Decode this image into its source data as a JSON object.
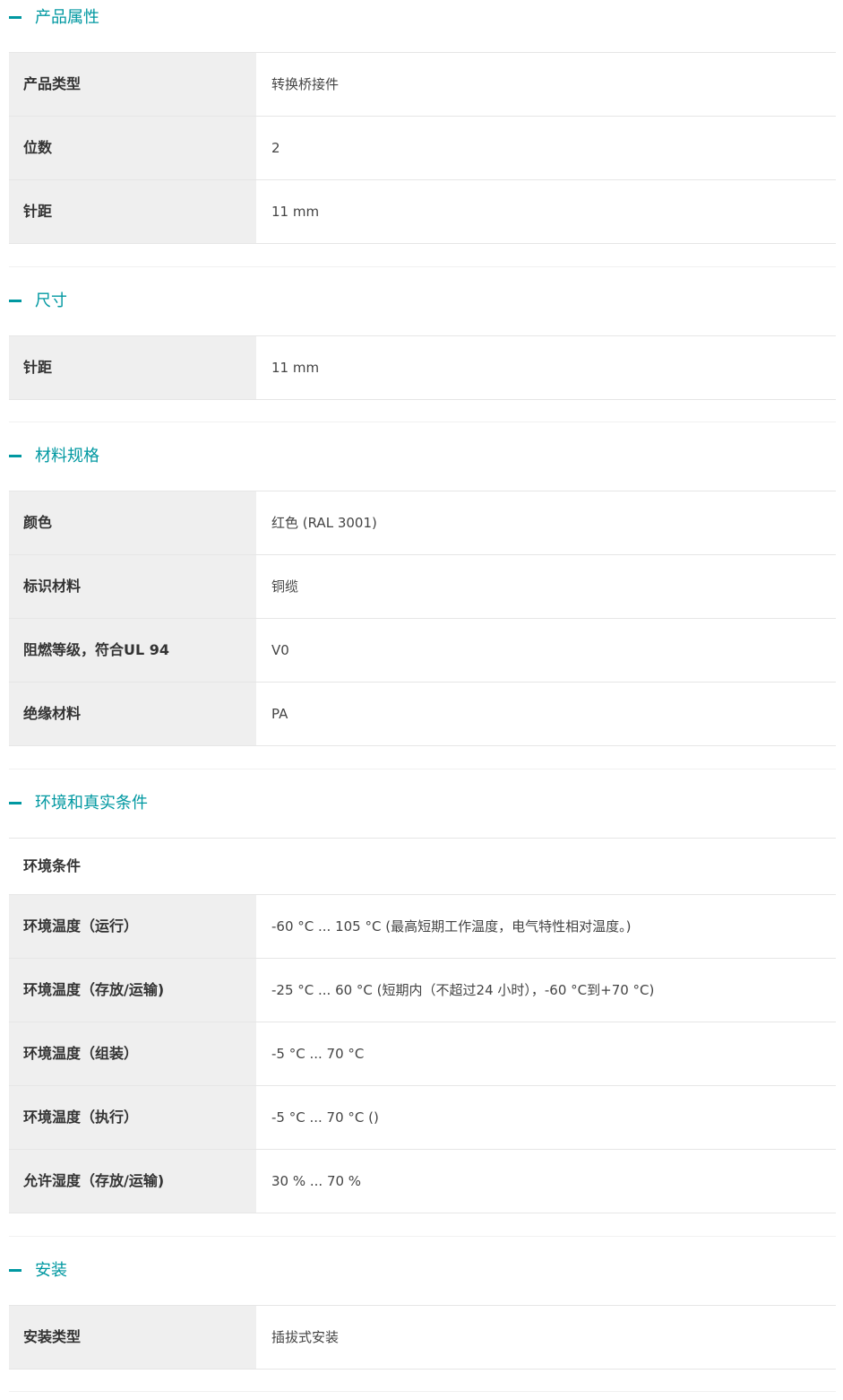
{
  "sections": [
    {
      "title": "产品属性",
      "rows": [
        {
          "label": "产品类型",
          "value": "转换桥接件"
        },
        {
          "label": "位数",
          "value": "2"
        },
        {
          "label": "针距",
          "value": "11 mm"
        }
      ]
    },
    {
      "title": "尺寸",
      "rows": [
        {
          "label": "针距",
          "value": "11 mm"
        }
      ]
    },
    {
      "title": "材料规格",
      "rows": [
        {
          "label": "颜色",
          "value": "红色 (RAL 3001)"
        },
        {
          "label": "标识材料",
          "value": "铜缆"
        },
        {
          "label": "阻燃等级，符合UL 94",
          "value": "V0"
        },
        {
          "label": "绝缘材料",
          "value": "PA"
        }
      ]
    },
    {
      "title": "环境和真实条件",
      "subheader": "环境条件",
      "rows": [
        {
          "label": "环境温度（运行）",
          "value": "-60 °C ... 105 °C (最高短期工作温度，电气特性相对温度。)"
        },
        {
          "label": "环境温度（存放/运输)",
          "value": "-25 °C ... 60 °C (短期内（不超过24 小时），-60 °C到+70 °C)"
        },
        {
          "label": "环境温度（组装）",
          "value": "-5 °C ... 70 °C"
        },
        {
          "label": "环境温度（执行）",
          "value": "-5 °C ... 70 °C ()"
        },
        {
          "label": "允许湿度（存放/运输)",
          "value": "30 % ... 70 %"
        }
      ]
    },
    {
      "title": "安装",
      "rows": [
        {
          "label": "安装类型",
          "value": "插拔式安装"
        }
      ]
    }
  ],
  "colors": {
    "accent": "#0098a1",
    "label_bg": "#efefef",
    "border": "#e6e6e6"
  },
  "icons": {
    "section_toggle": "minus-icon"
  }
}
